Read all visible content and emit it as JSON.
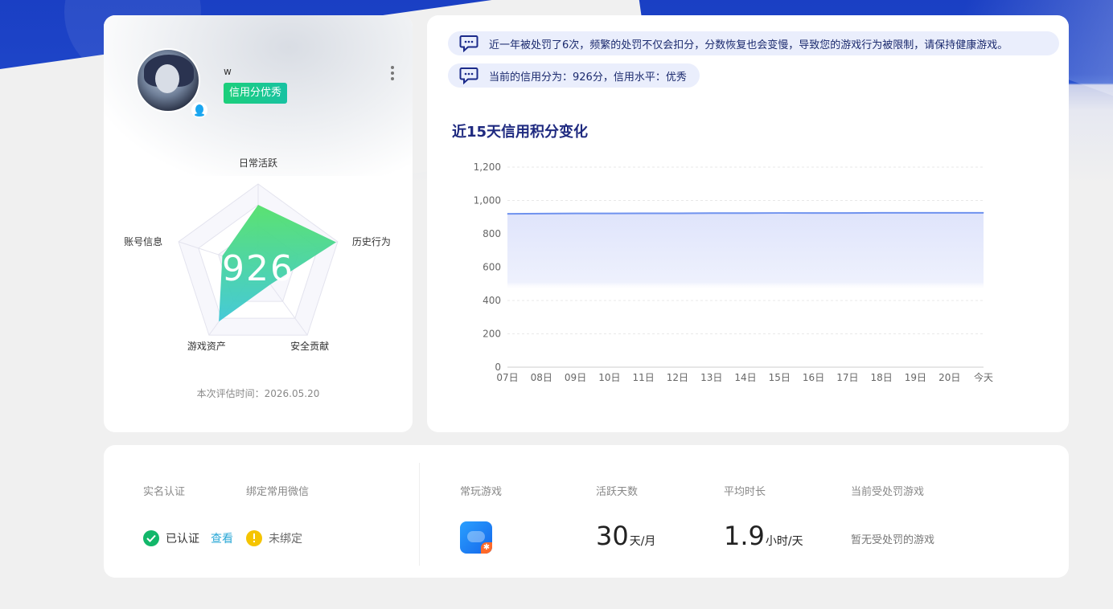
{
  "profile": {
    "username": "w",
    "credit_tag": "信用分优秀",
    "score": "926",
    "eval_time": "本次评估时间：2026.05.20"
  },
  "radar": {
    "axes": [
      "日常活跃",
      "历史行为",
      "安全贡献",
      "游戏资产",
      "账号信息"
    ],
    "values": [
      0.75,
      0.98,
      0.25,
      0.8,
      0.45
    ],
    "fill_colors": [
      "#52e06a",
      "#3cc7d6"
    ]
  },
  "notices": {
    "n1": "近一年被处罚了6次，频繁的处罚不仅会扣分，分数恢复也会变慢，导致您的游戏行为被限制，请保持健康游戏。",
    "n2": "当前的信用分为：926分，信用水平：优秀"
  },
  "chart_data": {
    "type": "area",
    "title": "近15天信用积分变化",
    "x": [
      "07日",
      "08日",
      "09日",
      "10日",
      "11日",
      "12日",
      "13日",
      "14日",
      "15日",
      "16日",
      "17日",
      "18日",
      "19日",
      "20日",
      "今天"
    ],
    "series": [
      {
        "values": [
          920,
          921,
          922,
          922,
          923,
          923,
          924,
          924,
          925,
          925,
          925,
          926,
          926,
          926,
          926
        ]
      }
    ],
    "yticks": [
      "0",
      "200",
      "400",
      "600",
      "800",
      "1,000",
      "1,200"
    ],
    "ylim": [
      0,
      1200
    ],
    "line_color": "#6f92ee",
    "fill_color": "#dfe5fb"
  },
  "bottom": {
    "realname_label": "实名认证",
    "wechat_label": "绑定常用微信",
    "realname_status": "已认证",
    "view_link": "查看",
    "wechat_status": "未绑定",
    "fav_game_label": "常玩游戏",
    "active_days_label": "活跃天数",
    "active_days_value": "30",
    "active_days_unit": "天/月",
    "avg_time_label": "平均时长",
    "avg_time_value": "1.9",
    "avg_time_unit": "小时/天",
    "punish_label": "当前受处罚游戏",
    "punish_text": "暂无受处罚的游戏"
  }
}
